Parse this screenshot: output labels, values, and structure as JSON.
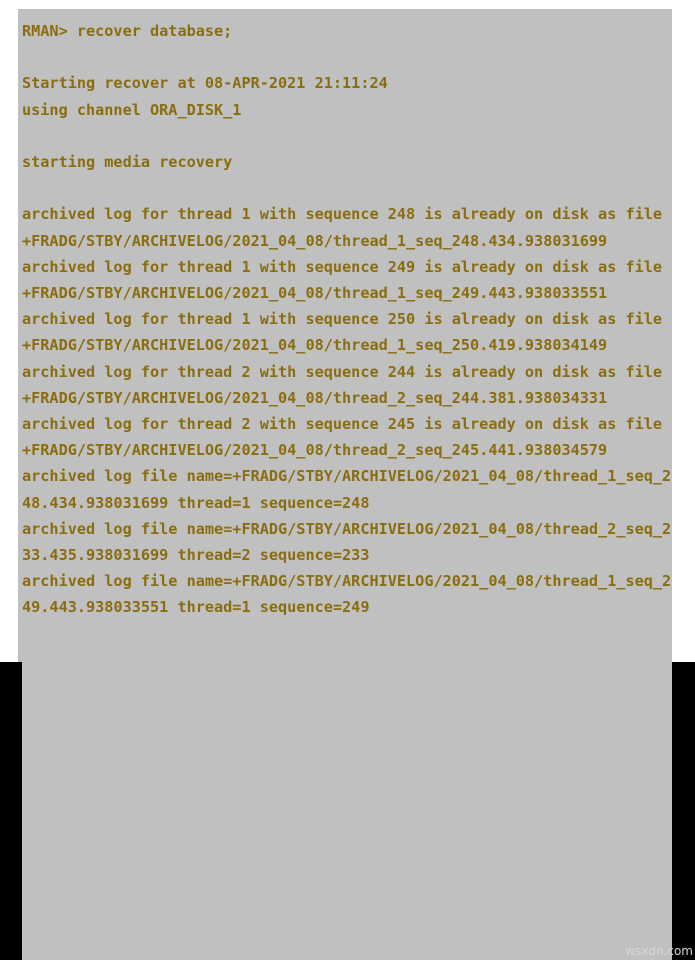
{
  "terminal": {
    "prompt_line": "RMAN> recover database;",
    "lines": [
      "RMAN> recover database;",
      "",
      "Starting recover at 08-APR-2021 21:11:24",
      "using channel ORA_DISK_1",
      "",
      "starting media recovery",
      "",
      "archived log for thread 1 with sequence 248 is already on disk as file +FRADG/STBY/ARCHIVELOG/2021_04_08/thread_1_seq_248.434.938031699",
      "archived log for thread 1 with sequence 249 is already on disk as file +FRADG/STBY/ARCHIVELOG/2021_04_08/thread_1_seq_249.443.938033551",
      "archived log for thread 1 with sequence 250 is already on disk as file +FRADG/STBY/ARCHIVELOG/2021_04_08/thread_1_seq_250.419.938034149",
      "archived log for thread 2 with sequence 244 is already on disk as file +FRADG/STBY/ARCHIVELOG/2021_04_08/thread_2_seq_244.381.938034331",
      "archived log for thread 2 with sequence 245 is already on disk as file +FRADG/STBY/ARCHIVELOG/2021_04_08/thread_2_seq_245.441.938034579",
      "archived log file name=+FRADG/STBY/ARCHIVELOG/2021_04_08/thread_1_seq_248.434.938031699 thread=1 sequence=248",
      "archived log file name=+FRADG/STBY/ARCHIVELOG/2021_04_08/thread_2_seq_233.435.938031699 thread=2 sequence=233",
      "archived log file name=+FRADG/STBY/ARCHIVELOG/2021_04_08/thread_1_seq_249.443.938033551 thread=1 sequence=249"
    ],
    "colors": {
      "text": "#8a6d0f",
      "background": "#c0c0c0",
      "page_background": "#ffffff",
      "edge_band": "#000000"
    }
  },
  "watermark": {
    "text": "wsxdn.com"
  }
}
